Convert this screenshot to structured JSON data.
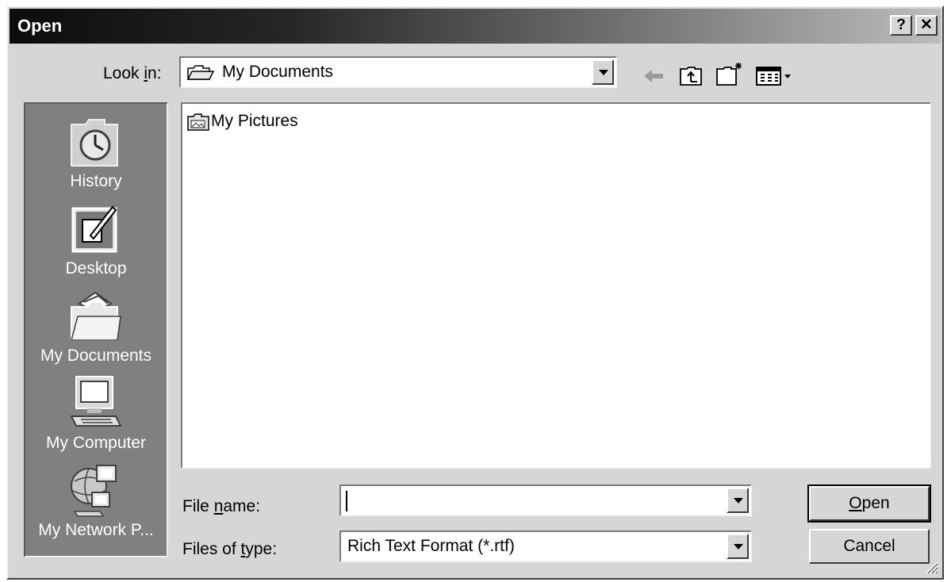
{
  "dialog": {
    "title": "Open",
    "help_label": "?",
    "close_label": "✕"
  },
  "look_in": {
    "label_pre": "Look ",
    "label_key": "i",
    "label_post": "n:",
    "value": "My Documents"
  },
  "toolbar": {
    "icons": [
      "back-arrow-icon",
      "up-one-level-icon",
      "create-new-folder-icon",
      "view-menu-icon"
    ]
  },
  "places": [
    {
      "label": "History",
      "icon": "history-icon"
    },
    {
      "label": "Desktop",
      "icon": "desktop-icon"
    },
    {
      "label": "My Documents",
      "icon": "my-documents-icon"
    },
    {
      "label": "My Computer",
      "icon": "my-computer-icon"
    },
    {
      "label": "My Network P...",
      "icon": "my-network-places-icon"
    }
  ],
  "files": [
    {
      "name": "My Pictures",
      "icon": "pictures-folder-icon"
    }
  ],
  "file_name": {
    "label_pre": "File ",
    "label_key": "n",
    "label_post": "ame:",
    "value": ""
  },
  "file_type": {
    "label_pre": "Files of ",
    "label_key": "t",
    "label_post": "ype:",
    "value": "Rich Text Format (*.rtf)"
  },
  "buttons": {
    "open_key": "O",
    "open_rest": "pen",
    "cancel": "Cancel"
  }
}
